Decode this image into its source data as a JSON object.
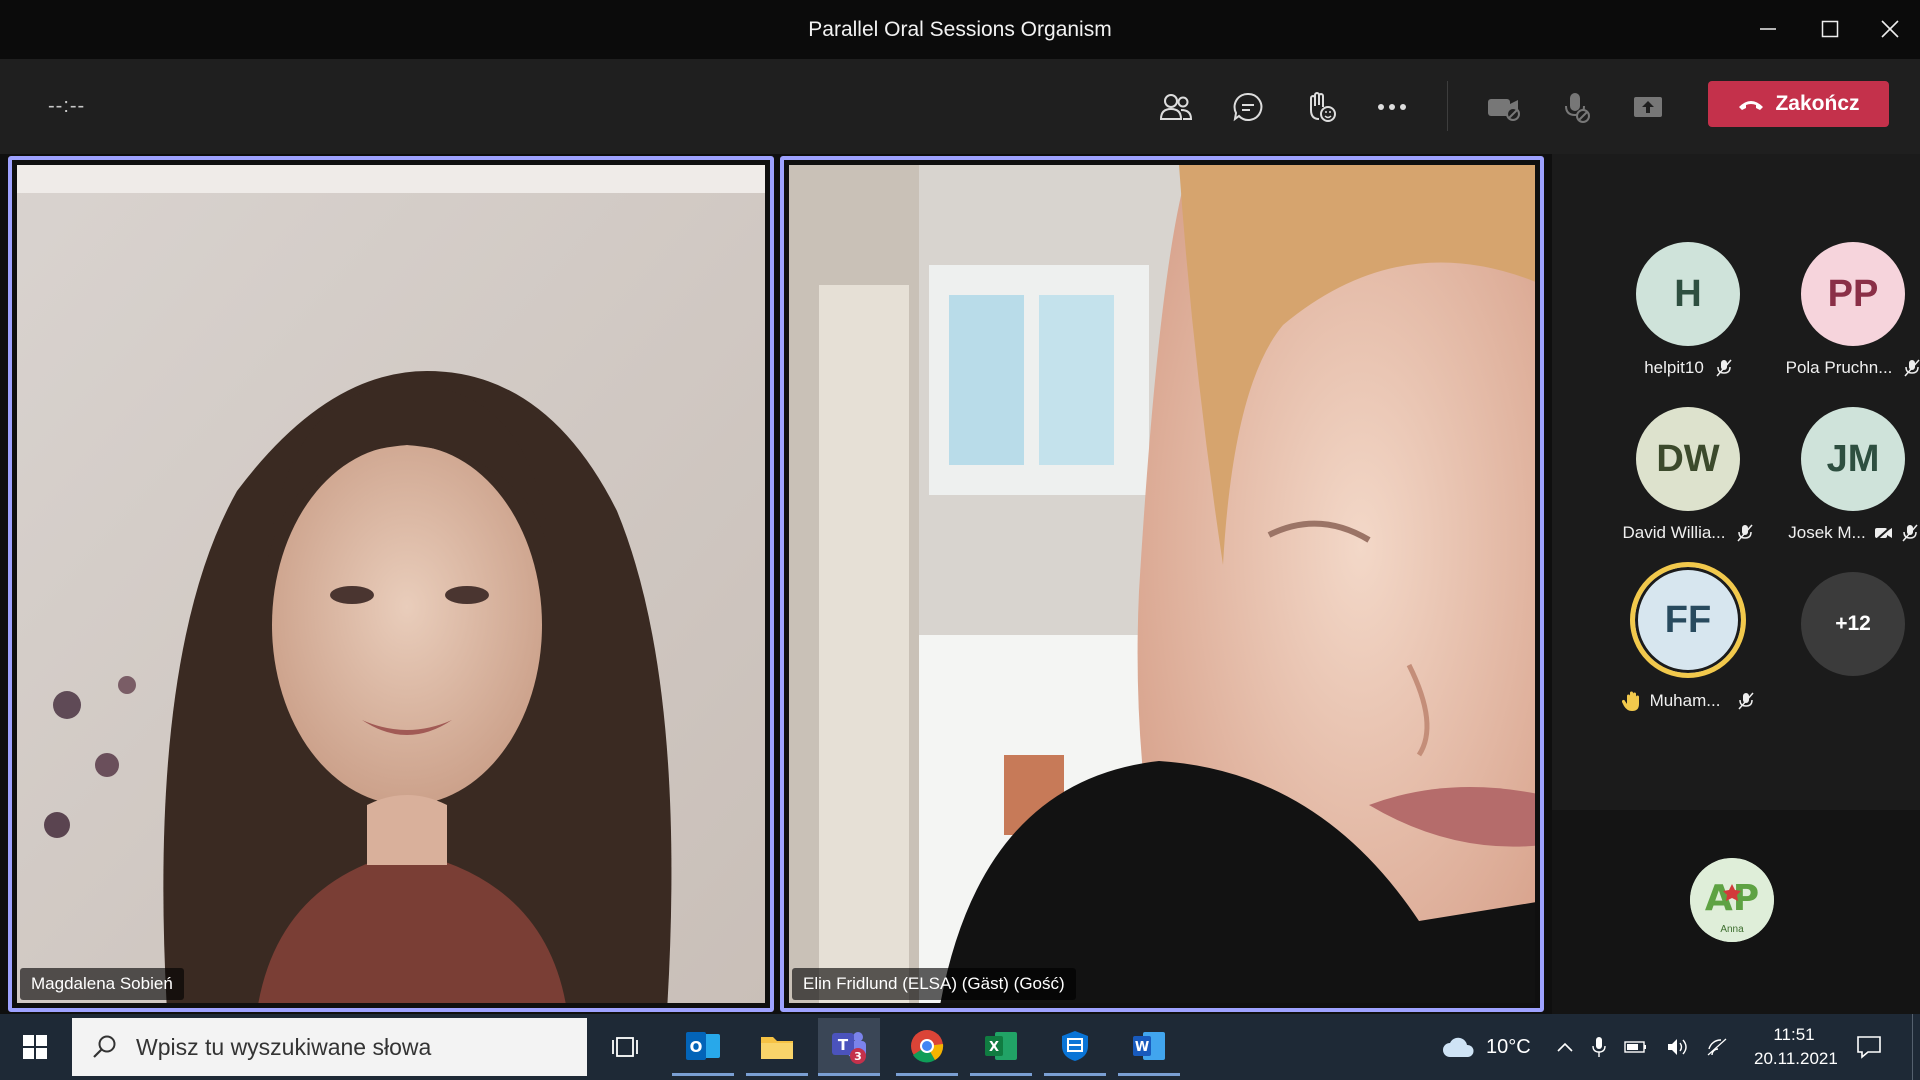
{
  "window": {
    "title": "Parallel Oral Sessions Organism"
  },
  "meeting": {
    "timer": "--:--",
    "end_label": "Zakończ"
  },
  "tiles": [
    {
      "name": "Magdalena Sobień"
    },
    {
      "name": "Elin Fridlund (ELSA) (Gäst) (Gość)"
    }
  ],
  "participants": [
    {
      "initials": "H",
      "name": "helpit10",
      "bg": "#cfe3da",
      "fg": "#2e4f40"
    },
    {
      "initials": "PP",
      "name": "Pola Pruchn...",
      "bg": "#f6d4dc",
      "fg": "#8a2f47"
    },
    {
      "initials": "DW",
      "name": "David Willia...",
      "bg": "#dde2cd",
      "fg": "#3c4a2c"
    },
    {
      "initials": "JM",
      "name": "Josek M...",
      "bg": "#cfe3da",
      "fg": "#2e4f40"
    },
    {
      "initials": "FF",
      "name": "Muham...",
      "bg": "#d7e6ef",
      "fg": "#284a5e"
    }
  ],
  "overflow": {
    "label": "+12"
  },
  "self_avatar": {
    "text": "Anna",
    "logo_text": "AP"
  },
  "taskbar": {
    "search_placeholder": "Wpisz tu wyszukiwane słowa",
    "teams_badge": "3",
    "weather": "10°C",
    "time": "11:51",
    "date": "20.11.2021"
  },
  "colors": {
    "accent": "#9ea2ff",
    "end_call": "#c4314b",
    "raised_hand": "#f2c94c"
  }
}
